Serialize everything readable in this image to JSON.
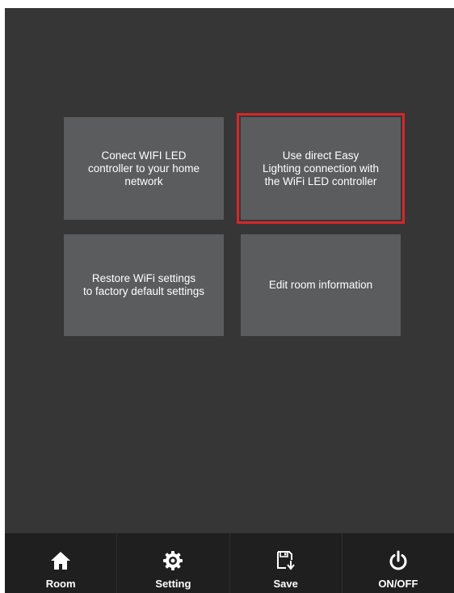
{
  "tiles": {
    "connect_home": "Conect WIFI LED\ncontroller to your home\nnetwork",
    "direct_connection": "Use direct Easy\nLighting connection with\nthe WiFi LED controller",
    "restore_defaults": "Restore WiFi settings\nto factory default settings",
    "edit_room": "Edit room information"
  },
  "bottom_nav": {
    "room": {
      "label": "Room",
      "icon": "home-icon"
    },
    "setting": {
      "label": "Setting",
      "icon": "gear-icon"
    },
    "save": {
      "label": "Save",
      "icon": "save-icon"
    },
    "onoff": {
      "label": "ON/OFF",
      "icon": "power-icon"
    }
  },
  "colors": {
    "background": "#363636",
    "tile": "#5b5c5e",
    "selection_border": "#d8262b",
    "nav_bar": "#1f1f20"
  }
}
